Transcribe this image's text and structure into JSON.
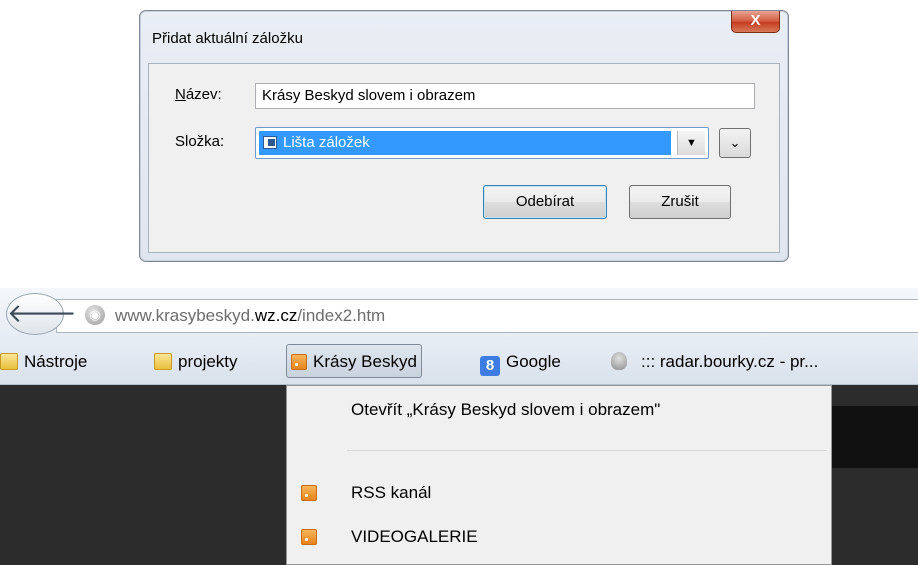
{
  "dialog": {
    "title": "Přidat aktuální záložku",
    "close_label": "X",
    "name_label_accel": "N",
    "name_label_rest": "ázev:",
    "name_value": "Krásy Beskyd slovem i obrazem",
    "folder_label": "Složka:",
    "folder_value": "Lišta záložek",
    "primary_button": "Odebírat",
    "cancel_button": "Zrušit"
  },
  "browser": {
    "back_icon": "back-arrow-icon",
    "url_prefix": "www.krasybeskyd.",
    "url_host": "wz.cz",
    "url_path": "/index2.htm",
    "bookmarks": [
      {
        "label": "Nástroje",
        "icon": "folder-icon"
      },
      {
        "label": "projekty",
        "icon": "folder-icon"
      },
      {
        "label": "Krásy Beskyd",
        "icon": "rss-icon"
      },
      {
        "label": "Google",
        "icon": "google-icon"
      },
      {
        "label": "::: radar.bourky.cz - pr...",
        "icon": "radar-icon"
      }
    ],
    "menu": {
      "open_item": "Otevřít „Krásy Beskyd slovem i obrazem\"",
      "items": [
        {
          "label": "RSS kanál",
          "icon": "rss-icon"
        },
        {
          "label": "VIDEOGALERIE",
          "icon": "rss-icon"
        }
      ]
    }
  },
  "colors": {
    "selection": "#3399ff",
    "rss": "#e8841c"
  }
}
